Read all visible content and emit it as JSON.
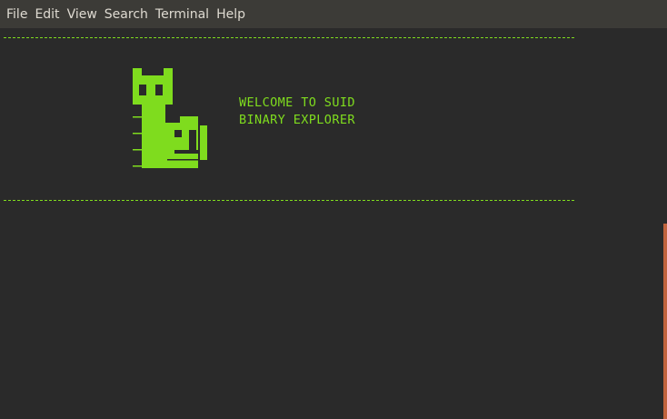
{
  "menubar": {
    "items": [
      "File",
      "Edit",
      "View",
      "Search",
      "Terminal",
      "Help"
    ]
  },
  "terminal": {
    "banner_line_1": "WELCOME TO SUID",
    "banner_line_2": "BINARY EXPLORER",
    "ascii_art_icon": "cat-icon",
    "text_color": "#7fdc1e",
    "background_color": "#2a2a2a",
    "accent_color": "#c0633d"
  }
}
